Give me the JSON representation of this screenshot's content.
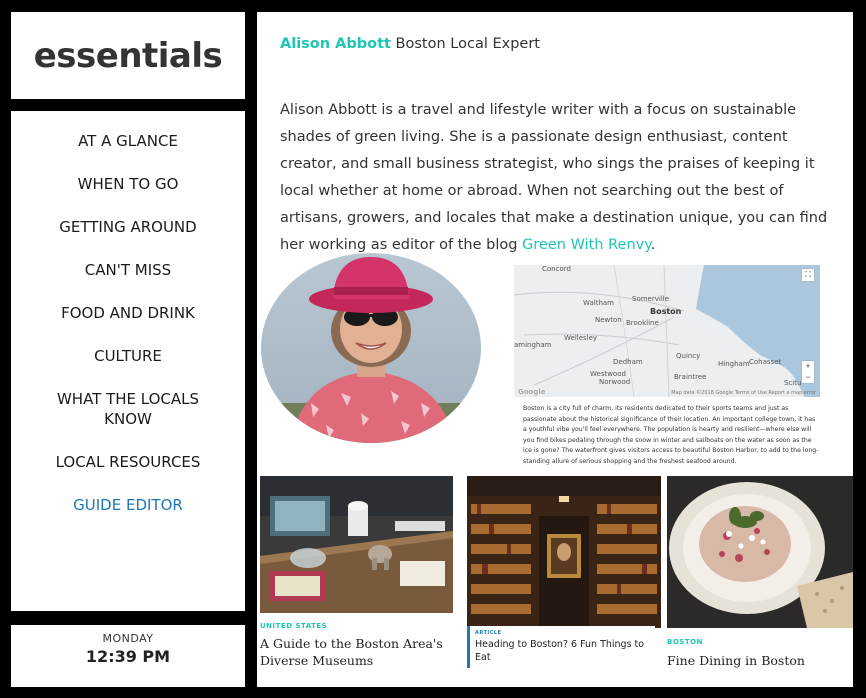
{
  "logo": {
    "text": "essentials"
  },
  "nav": {
    "items": [
      {
        "label": "AT A GLANCE"
      },
      {
        "label": "WHEN TO GO"
      },
      {
        "label": "GETTING AROUND"
      },
      {
        "label": "CAN'T MISS"
      },
      {
        "label": "FOOD AND DRINK"
      },
      {
        "label": "CULTURE"
      },
      {
        "label": "WHAT THE LOCALS KNOW"
      },
      {
        "label": "LOCAL RESOURCES"
      },
      {
        "label": "GUIDE EDITOR",
        "active": true
      }
    ]
  },
  "clock": {
    "day": "MONDAY",
    "time": "12:39 PM"
  },
  "author": {
    "name": "Alison Abbott",
    "role": "Boston Local Expert",
    "bio_text": "Alison Abbott is a travel and lifestyle writer with a focus on sustainable shades of green living. She is a passionate design enthusiast, content creator, and small business strategist, who sings the praises of keeping it local whether at home or abroad. When not searching out the best of artisans, growers, and locales that make a destination unique, you can find her working as editor of the blog ",
    "bio_link": "Green With Renvy",
    "bio_end": "."
  },
  "map": {
    "labels": {
      "concord": "Concord",
      "somerville": "Somerville",
      "waltham": "Waltham",
      "boston": "Boston",
      "newton": "Newton",
      "brookline": "Brookline",
      "wellesley": "Wellesley",
      "framingham": "amingham",
      "dedham": "Dedham",
      "quincy": "Quincy",
      "hingham": "Hingham",
      "cohasset": "Cohasset",
      "westwood": "Westwood",
      "norwood": "Norwood",
      "braintree": "Braintree",
      "scituate": "Scitu"
    },
    "google": "Google",
    "attribution": "Map data ©2018 Google   Terms of Use   Report a map error",
    "zoom_in": "+",
    "zoom_out": "−",
    "fullscreen": "⛶",
    "description": "Boston is a city full of charm, its residents dedicated to their sports teams and just as passionate about the historical significance of their location. An important college town, it has a youthful vibe you'll feel everywhere. The population is hearty and resilient—where else will you find bikes pedaling through the snow in winter and sailboats on the water as soon as the ice is gone? The waterfront gives visitors access to beautiful Boston Harbor, to add to the long-standing allure of serious shopping and the freshest seafood around."
  },
  "cards": [
    {
      "tag": "UNITED STATES",
      "title": "A Guide to the Boston Area's Diverse Museums"
    },
    {
      "tag": "ARTICLE",
      "title": "Heading to Boston? 6 Fun Things to Eat"
    },
    {
      "tag": "BOSTON",
      "title": "Fine Dining in Boston"
    }
  ]
}
